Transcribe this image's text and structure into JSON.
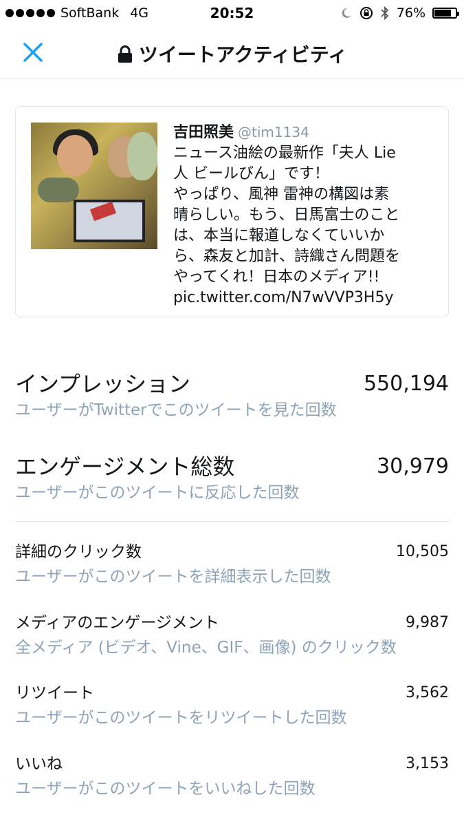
{
  "status": {
    "carrier": "SoftBank",
    "network": "4G",
    "time": "20:52",
    "battery": "76%",
    "battery_level": 0.76
  },
  "nav": {
    "title": "ツイートアクティビティ",
    "close_icon": "close-icon",
    "lock_icon": "lock-icon",
    "accent_color": "#1da1f2"
  },
  "tweet": {
    "name": "吉田照美",
    "handle": "@tim1134",
    "lines": [
      "ニュース油絵の最新作「夫人 Lie",
      "人 ビールびん」です！",
      "やっぱり、風神 雷神の構図は素",
      "晴らしい。もう、日馬富士のこと",
      "は、本当に報道しなくていいか",
      "ら、森友と加計、詩織さん問題を",
      "やってくれ！日本のメディア!!",
      "pic.twitter.com/N7wVVP3H5y"
    ]
  },
  "metrics": [
    {
      "label": "インプレッション",
      "value": "550,194",
      "desc": "ユーザーがTwitterでこのツイートを見た回数"
    },
    {
      "label": "エンゲージメント総数",
      "value": "30,979",
      "desc": "ユーザーがこのツイートに反応した回数"
    },
    {
      "label": "詳細のクリック数",
      "value": "10,505",
      "desc": "ユーザーがこのツイートを詳細表示した回数"
    },
    {
      "label": "メディアのエンゲージメント",
      "value": "9,987",
      "desc": "全メディア (ビデオ、Vine、GIF、画像) のクリック数"
    },
    {
      "label": "リツイート",
      "value": "3,562",
      "desc": "ユーザーがこのツイートをリツイートした回数"
    },
    {
      "label": "いいね",
      "value": "3,153",
      "desc": "ユーザーがこのツイートをいいねした回数"
    }
  ]
}
